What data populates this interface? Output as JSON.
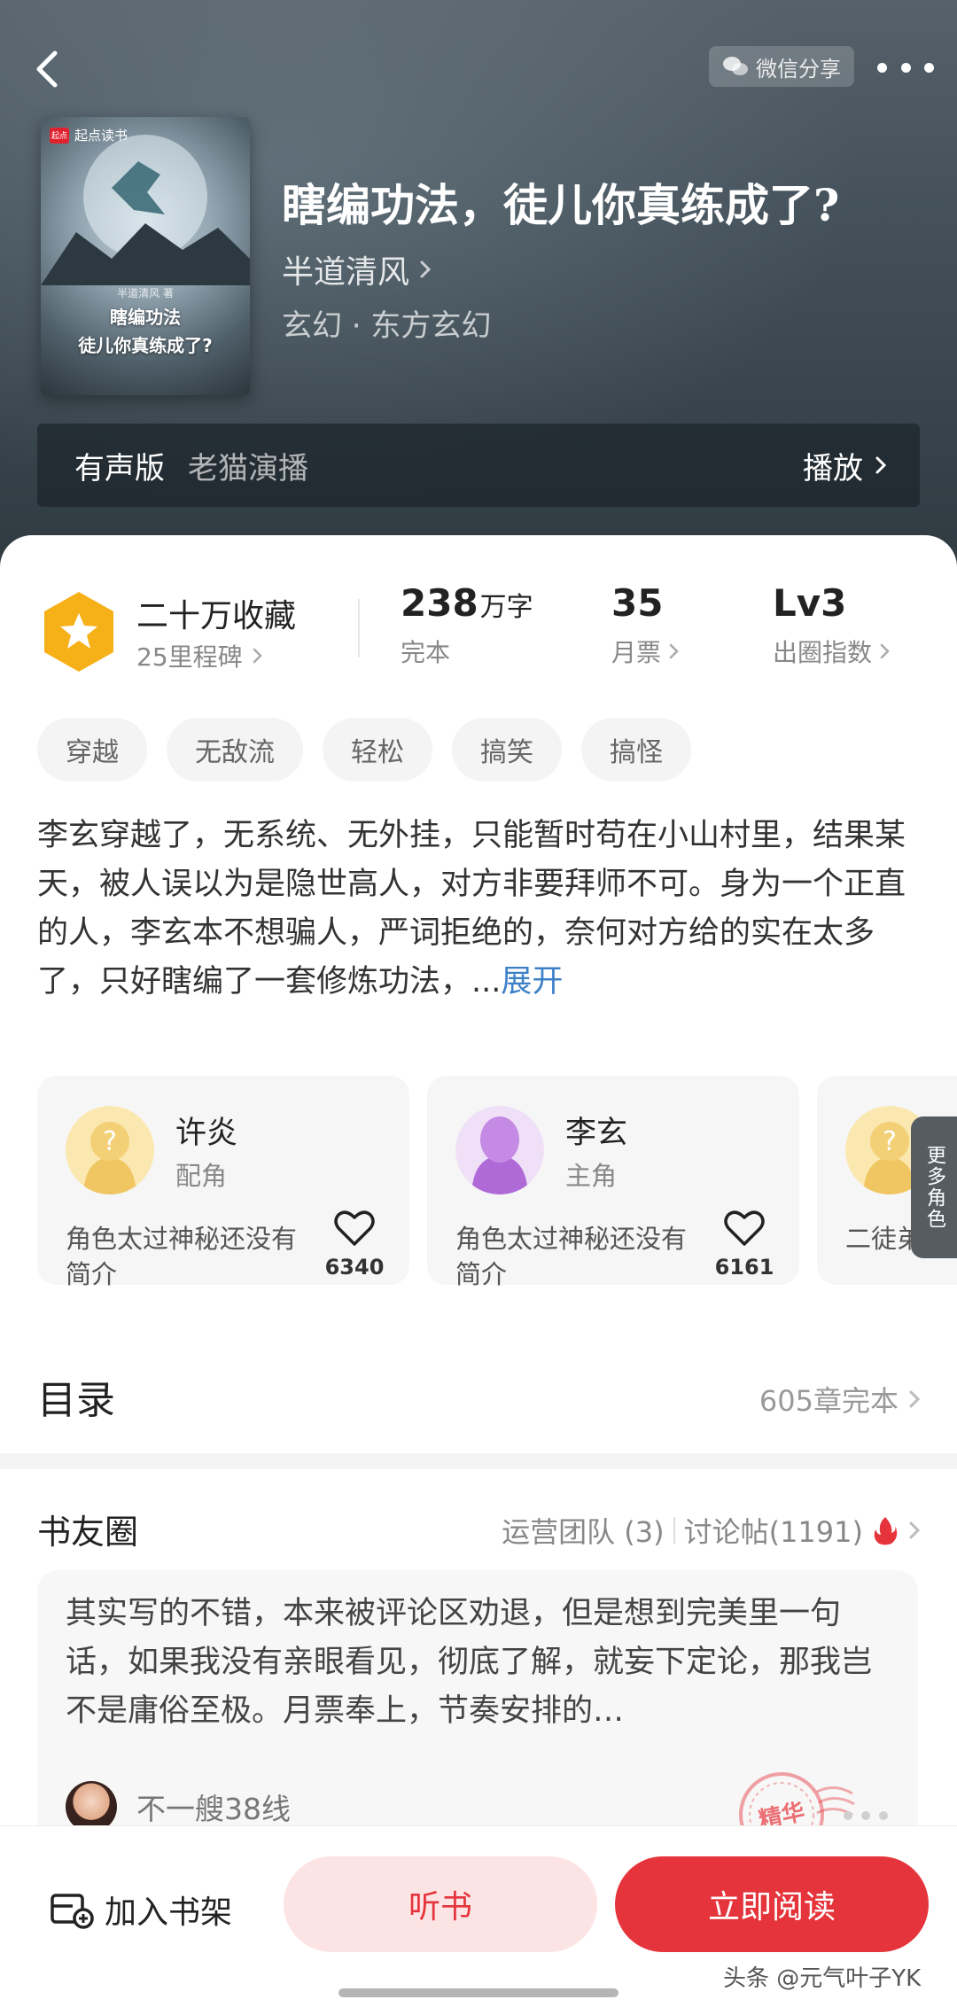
{
  "header": {
    "share_label": "微信分享",
    "cover": {
      "brand": "起点读书",
      "brand_mark": "起点",
      "author": "半道清风 著",
      "title_line1": "瞎编功法",
      "title_line2": "徒儿你真练成了?"
    },
    "title": "瞎编功法，徒儿你真练成了?",
    "author": "半道清风",
    "genre": "玄幻 · 东方玄幻"
  },
  "audio": {
    "label": "有声版",
    "narrator": "老猫演播",
    "play": "播放"
  },
  "stats": {
    "favorites": "二十万收藏",
    "milestones": "25里程碑",
    "words_value": "238",
    "words_unit": "万字",
    "words_label": "完本",
    "monthly_value": "35",
    "monthly_label": "月票",
    "level_value": "Lv3",
    "level_label": "出圈指数"
  },
  "tags": [
    "穿越",
    "无敌流",
    "轻松",
    "搞笑",
    "搞怪"
  ],
  "synopsis": {
    "text": "李玄穿越了，无系统、无外挂，只能暂时苟在小山村里，结果某天，被人误以为是隐世高人，对方非要拜师不可。身为一个正直的人，李玄本不想骗人，严词拒绝的，奈何对方给的实在太多了，只好瞎编了一套修炼功法，...",
    "expand": "展开"
  },
  "characters": [
    {
      "name": "许炎",
      "role": "配角",
      "desc": "角色太过神秘还没有简介",
      "likes": "6340"
    },
    {
      "name": "李玄",
      "role": "主角",
      "desc": "角色太过神秘还没有简介",
      "likes": "6161"
    },
    {
      "name": "",
      "role": "",
      "desc": "二徒弟",
      "likes": ""
    }
  ],
  "more_characters": "更多角色",
  "toc": {
    "title": "目录",
    "status": "605章完本"
  },
  "circle": {
    "title": "书友圈",
    "ops": "运营团队 (3)",
    "posts": "讨论帖(1191)"
  },
  "post": {
    "text": "其实写的不错，本来被评论区劝退，但是想到完美里一句话，如果我没有亲眼看见，彻底了解，就妄下定论，那我岂不是庸俗至极。月票奉上，节奏安排的…",
    "username": "不一艘38线",
    "stamp": "精华"
  },
  "bottom": {
    "shelf": "加入书架",
    "listen": "听书",
    "read": "立即阅读"
  },
  "watermark": "头条 @元气叶子YK",
  "colors": {
    "accent": "#e5343b",
    "accent_light": "#fde4e4",
    "link": "#3c80c8",
    "badge": "#f6b018"
  }
}
